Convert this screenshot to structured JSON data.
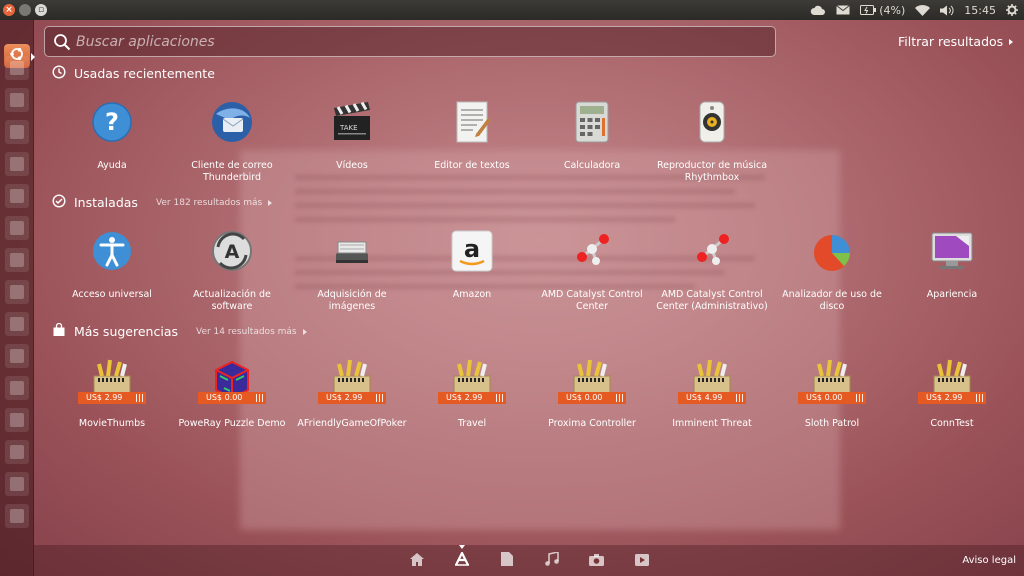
{
  "top_panel": {
    "battery": "(4%)",
    "clock": "15:45"
  },
  "search": {
    "placeholder": "Buscar aplicaciones",
    "value": ""
  },
  "filter_label": "Filtrar resultados",
  "sections": {
    "recent": {
      "title": "Usadas recientemente",
      "items": [
        {
          "label": "Ayuda",
          "icon": "help-icon"
        },
        {
          "label": "Cliente de correo Thunderbird",
          "icon": "thunderbird-icon"
        },
        {
          "label": "Vídeos",
          "icon": "clapperboard-icon"
        },
        {
          "label": "Editor de textos",
          "icon": "text-editor-icon"
        },
        {
          "label": "Calculadora",
          "icon": "calculator-icon"
        },
        {
          "label": "Reproductor de música Rhythmbox",
          "icon": "rhythmbox-icon"
        }
      ]
    },
    "installed": {
      "title": "Instaladas",
      "more": "Ver 182 resultados más",
      "items": [
        {
          "label": "Acceso universal",
          "icon": "accessibility-icon"
        },
        {
          "label": "Actualización de software",
          "icon": "software-update-icon"
        },
        {
          "label": "Adquisición de imágenes",
          "icon": "scanner-icon"
        },
        {
          "label": "Amazon",
          "icon": "amazon-icon"
        },
        {
          "label": "AMD Catalyst Control Center",
          "icon": "molecule-icon"
        },
        {
          "label": "AMD Catalyst Control Center (Administrativo)",
          "icon": "molecule-icon"
        },
        {
          "label": "Analizador de uso de disco",
          "icon": "pie-chart-icon"
        },
        {
          "label": "Apariencia",
          "icon": "monitor-icon"
        }
      ]
    },
    "suggestions": {
      "title": "Más sugerencias",
      "more": "Ver 14 resultados más",
      "items": [
        {
          "label": "MovieThumbs",
          "price": "US$ 2.99",
          "icon": "package-icon"
        },
        {
          "label": "PoweRay Puzzle Demo",
          "price": "US$ 0.00",
          "icon": "puzzle-cube-icon"
        },
        {
          "label": "AFriendlyGameOfPoker",
          "price": "US$ 2.99",
          "icon": "package-icon"
        },
        {
          "label": "Travel",
          "price": "US$ 2.99",
          "icon": "package-icon"
        },
        {
          "label": "Proxima Controller",
          "price": "US$ 0.00",
          "icon": "package-icon"
        },
        {
          "label": "Imminent Threat",
          "price": "US$ 4.99",
          "icon": "package-icon"
        },
        {
          "label": "Sloth Patrol",
          "price": "US$ 0.00",
          "icon": "package-icon"
        },
        {
          "label": "ConnTest",
          "price": "US$ 2.99",
          "icon": "package-icon"
        }
      ]
    }
  },
  "lenses": [
    {
      "icon": "home-icon"
    },
    {
      "icon": "applications-icon",
      "active": true
    },
    {
      "icon": "files-icon"
    },
    {
      "icon": "music-icon"
    },
    {
      "icon": "photos-icon"
    },
    {
      "icon": "video-icon"
    }
  ],
  "legal": "Aviso legal"
}
